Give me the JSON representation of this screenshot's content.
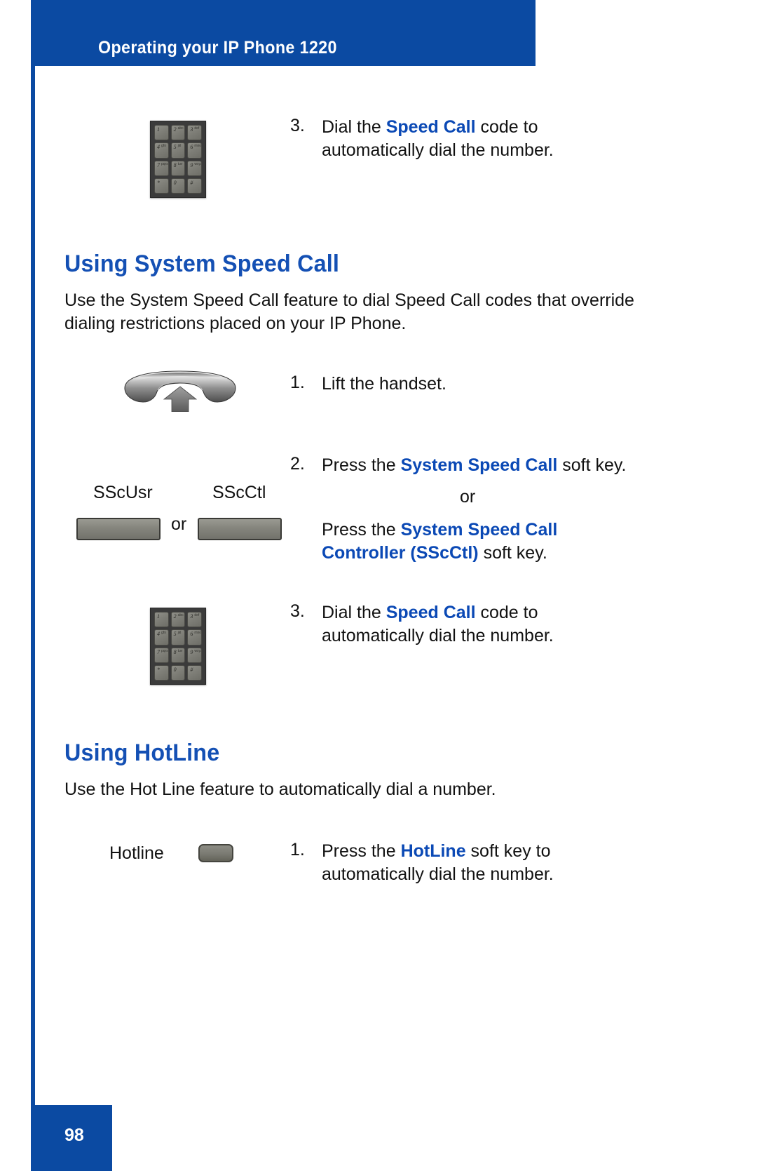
{
  "header": {
    "title": "Operating your IP Phone 1220"
  },
  "footer": {
    "page_number": "98"
  },
  "top_step": {
    "number": "3.",
    "text_before": "Dial the ",
    "highlight": "Speed Call",
    "text_after": " code to automatically dial the number.",
    "icon": "keypad-icon"
  },
  "section_speed_call": {
    "heading": "Using System Speed Call",
    "intro": "Use the System Speed Call feature to dial Speed Call codes that override dialing restrictions placed on your IP Phone.",
    "step1": {
      "number": "1.",
      "text": "Lift the handset.",
      "icon": "handset-icon"
    },
    "step2": {
      "number": "2.",
      "line1_before": "Press the ",
      "line1_highlight": "System Speed Call",
      "line1_after": " soft key.",
      "or": "or",
      "line2_before": "Press the ",
      "line2_highlight": "System Speed Call Controller (SScCtl)",
      "line2_after": " soft key.",
      "softkey_left_label": "SScUsr",
      "softkey_right_label": "SScCtl",
      "softkey_separator": "or"
    },
    "step3": {
      "number": "3.",
      "text_before": "Dial the ",
      "highlight": "Speed Call",
      "text_after": " code to automatically dial the number.",
      "icon": "keypad-icon"
    }
  },
  "section_hotline": {
    "heading": "Using HotLine",
    "intro": "Use the Hot Line feature to automatically dial a number.",
    "step1": {
      "number": "1.",
      "text_before": "Press the ",
      "highlight": "HotLine",
      "text_after": " soft key to automatically dial the number.",
      "softkey_label": "Hotline"
    }
  },
  "keypad_keys": [
    {
      "digit": "1",
      "letters": ""
    },
    {
      "digit": "2",
      "letters": "abc"
    },
    {
      "digit": "3",
      "letters": "def"
    },
    {
      "digit": "4",
      "letters": "ghi"
    },
    {
      "digit": "5",
      "letters": "jkl"
    },
    {
      "digit": "6",
      "letters": "mno"
    },
    {
      "digit": "7",
      "letters": "pqrs"
    },
    {
      "digit": "8",
      "letters": "tuv"
    },
    {
      "digit": "9",
      "letters": "wxyz"
    },
    {
      "digit": "*",
      "letters": ""
    },
    {
      "digit": "0",
      "letters": ""
    },
    {
      "digit": "#",
      "letters": ""
    }
  ],
  "colors": {
    "brand_blue": "#0b4aa2",
    "heading_blue": "#1450b4",
    "emphasis_blue": "#0b49b5",
    "text_black": "#111111"
  }
}
